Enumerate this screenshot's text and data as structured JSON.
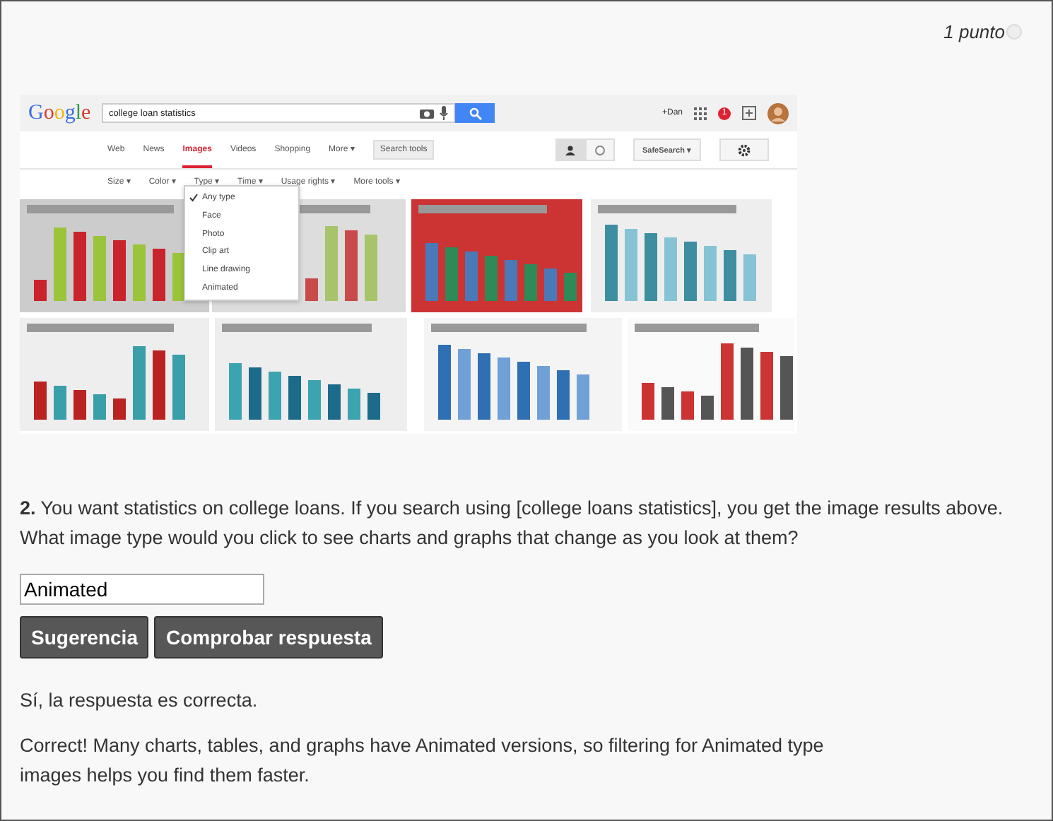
{
  "points": "1 punto",
  "screenshot": {
    "logo": "Google",
    "query": "college loan statistics",
    "user": "+Dan",
    "notifications": "1",
    "tabs": [
      {
        "label": "Web",
        "selected": false
      },
      {
        "label": "News",
        "selected": false
      },
      {
        "label": "Images",
        "selected": true
      },
      {
        "label": "Videos",
        "selected": false
      },
      {
        "label": "Shopping",
        "selected": false
      },
      {
        "label": "More ▾",
        "selected": false
      }
    ],
    "search_tools": "Search tools",
    "view_modes": [
      {
        "selected": true
      },
      {
        "selected": false
      }
    ],
    "safesearch": "SafeSearch ▾",
    "filters": [
      "Size ▾",
      "Color ▾",
      "Type ▾",
      "Time ▾",
      "Usage rights ▾",
      "More tools ▾"
    ],
    "type_menu": [
      {
        "label": "Any type",
        "checked": true
      },
      {
        "label": "Face",
        "checked": false
      },
      {
        "label": "Photo",
        "checked": false
      },
      {
        "label": "Clip art",
        "checked": false
      },
      {
        "label": "Line drawing",
        "checked": false
      },
      {
        "label": "Animated",
        "checked": false
      }
    ]
  },
  "question": {
    "number": "2.",
    "text": "You want statistics on college loans. If you search using [college loans statistics], you get the image results above. What image type would you click to see charts and graphs that change as you look at them?"
  },
  "answer": {
    "value": "Animated"
  },
  "buttons": [
    "Sugerencia",
    "Comprobar respuesta"
  ],
  "result": "Sí, la respuesta es correcta.",
  "feedback": "Correct! Many charts, tables, and graphs have Animated versions, so filtering for Animated type images helps you find them faster."
}
